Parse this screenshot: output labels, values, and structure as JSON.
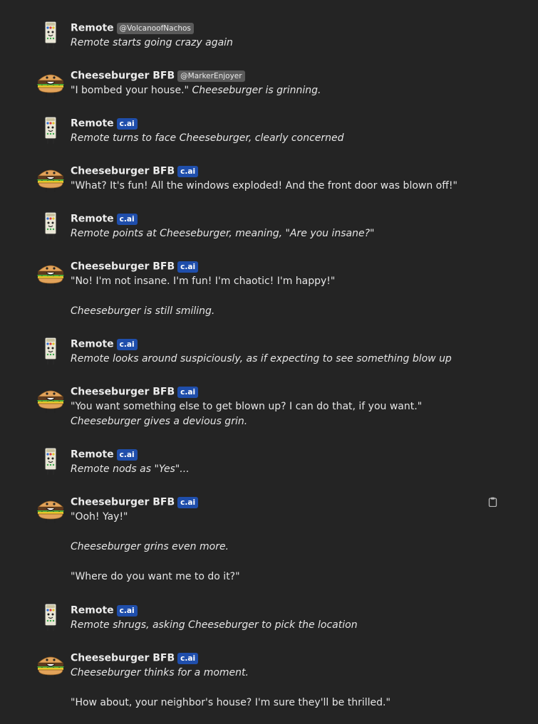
{
  "messages": [
    {
      "kind": "remote",
      "name": "Remote",
      "tag": "@VolcanoofNachos",
      "tag_type": "user",
      "paragraphs": [
        [
          {
            "text": "Remote starts going crazy again",
            "italic": true
          }
        ]
      ]
    },
    {
      "kind": "burger",
      "name": "Cheeseburger BFB",
      "tag": "@MarkerEnjoyer",
      "tag_type": "user",
      "paragraphs": [
        [
          {
            "text": "\"I bombed your house.\" ",
            "italic": false
          },
          {
            "text": "Cheeseburger is grinning.",
            "italic": true
          }
        ]
      ]
    },
    {
      "kind": "remote",
      "name": "Remote",
      "tag": "c.ai",
      "tag_type": "cai",
      "paragraphs": [
        [
          {
            "text": "Remote turns to face Cheeseburger, clearly concerned",
            "italic": true
          }
        ]
      ]
    },
    {
      "kind": "burger",
      "name": "Cheeseburger BFB",
      "tag": "c.ai",
      "tag_type": "cai",
      "paragraphs": [
        [
          {
            "text": "\"What? It's fun! All the windows exploded! And the front door was blown off!\"",
            "italic": false
          }
        ]
      ]
    },
    {
      "kind": "remote",
      "name": "Remote",
      "tag": "c.ai",
      "tag_type": "cai",
      "paragraphs": [
        [
          {
            "text": "Remote points at Cheeseburger, meaning, \"Are you insane?\"",
            "italic": true
          }
        ]
      ]
    },
    {
      "kind": "burger",
      "name": "Cheeseburger BFB",
      "tag": "c.ai",
      "tag_type": "cai",
      "paragraphs": [
        [
          {
            "text": "\"No! I'm not insane. I'm fun! I'm chaotic! I'm happy!\"",
            "italic": false
          }
        ],
        [
          {
            "text": "Cheeseburger is still smiling.",
            "italic": true
          }
        ]
      ]
    },
    {
      "kind": "remote",
      "name": "Remote",
      "tag": "c.ai",
      "tag_type": "cai",
      "paragraphs": [
        [
          {
            "text": "Remote looks around suspiciously, as if expecting to see something blow up",
            "italic": true
          }
        ]
      ]
    },
    {
      "kind": "burger",
      "name": "Cheeseburger BFB",
      "tag": "c.ai",
      "tag_type": "cai",
      "paragraphs": [
        [
          {
            "text": "\"You want something else to get blown up? I can do that, if you want.\" ",
            "italic": false
          },
          {
            "text": "Cheeseburger gives a devious grin.",
            "italic": true
          }
        ]
      ]
    },
    {
      "kind": "remote",
      "name": "Remote",
      "tag": "c.ai",
      "tag_type": "cai",
      "paragraphs": [
        [
          {
            "text": "Remote nods as \"Yes\"...",
            "italic": true
          }
        ]
      ]
    },
    {
      "kind": "burger",
      "name": "Cheeseburger BFB",
      "tag": "c.ai",
      "tag_type": "cai",
      "copy_icon": "clipboard-icon",
      "paragraphs": [
        [
          {
            "text": "\"Ooh! Yay!\"",
            "italic": false
          }
        ],
        [
          {
            "text": "Cheeseburger grins even more.",
            "italic": true
          }
        ],
        [
          {
            "text": "\"Where do you want me to do it?\"",
            "italic": false
          }
        ]
      ]
    },
    {
      "kind": "remote",
      "name": "Remote",
      "tag": "c.ai",
      "tag_type": "cai",
      "paragraphs": [
        [
          {
            "text": "Remote shrugs, asking Cheeseburger to pick the location",
            "italic": true
          }
        ]
      ]
    },
    {
      "kind": "burger",
      "name": "Cheeseburger BFB",
      "tag": "c.ai",
      "tag_type": "cai",
      "paragraphs": [
        [
          {
            "text": "Cheeseburger thinks for a moment.",
            "italic": true
          }
        ],
        [
          {
            "text": "\"How about, your neighbor's house? I'm sure they'll be thrilled.\"",
            "italic": false
          }
        ]
      ]
    }
  ],
  "colors": {
    "background": "#242424",
    "text": "#e6e6e6",
    "cai_badge": "#1f4eab",
    "user_badge": "#5a5a5a"
  }
}
